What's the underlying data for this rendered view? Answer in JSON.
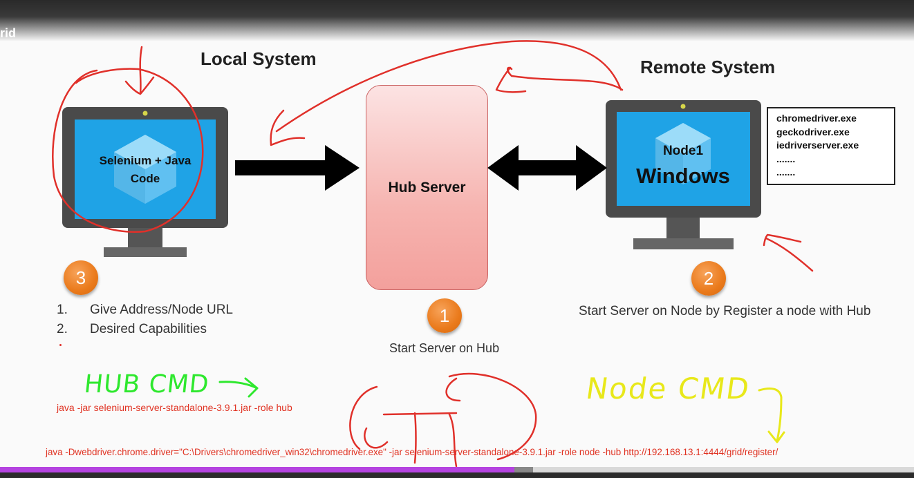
{
  "window": {
    "title_fragment": "rid"
  },
  "headings": {
    "local": "Local System",
    "remote": "Remote System"
  },
  "local_monitor": {
    "line1": "Selenium + Java",
    "line2": "Code"
  },
  "remote_monitor": {
    "node_label": "Node1",
    "os_label": "Windows"
  },
  "hub": {
    "label": "Hub Server"
  },
  "drivers": [
    "chromedriver.exe",
    "geckodriver.exe",
    "iedriverserver.exe",
    ".......",
    "......."
  ],
  "steps": [
    {
      "number": "1",
      "caption": "Start Server on Hub"
    },
    {
      "number": "2",
      "caption": "Start Server on Node by Register a node with Hub"
    },
    {
      "number": "3",
      "caption": ""
    }
  ],
  "local_list": [
    {
      "num": "1.",
      "text": "Give Address/Node URL"
    },
    {
      "num": "2.",
      "text": "Desired Capabilities"
    }
  ],
  "annotations": {
    "hub_cmd": "HUB CMD",
    "node_cmd": "Node CMD"
  },
  "commands": {
    "hub": "java -jar selenium-server-standalone-3.9.1.jar -role hub",
    "node": "java -Dwebdriver.chrome.driver=\"C:\\Drivers\\chromedriver_win32\\chromedriver.exe\" -jar selenium-server-standalone-3.9.1.jar -role node -hub http://192.168.13.1:4444/grid/register/"
  },
  "video_progress": {
    "played_fraction": 0.563,
    "buffered_fraction": 0.583
  },
  "colors": {
    "badge": "#ea7a1b",
    "command_text": "#e03222",
    "annotation_red": "#e0302a",
    "annotation_green": "#2ee82e",
    "annotation_yellow": "#e8e81a",
    "progress": "#b443e0",
    "screen": "#1fa3e6"
  }
}
